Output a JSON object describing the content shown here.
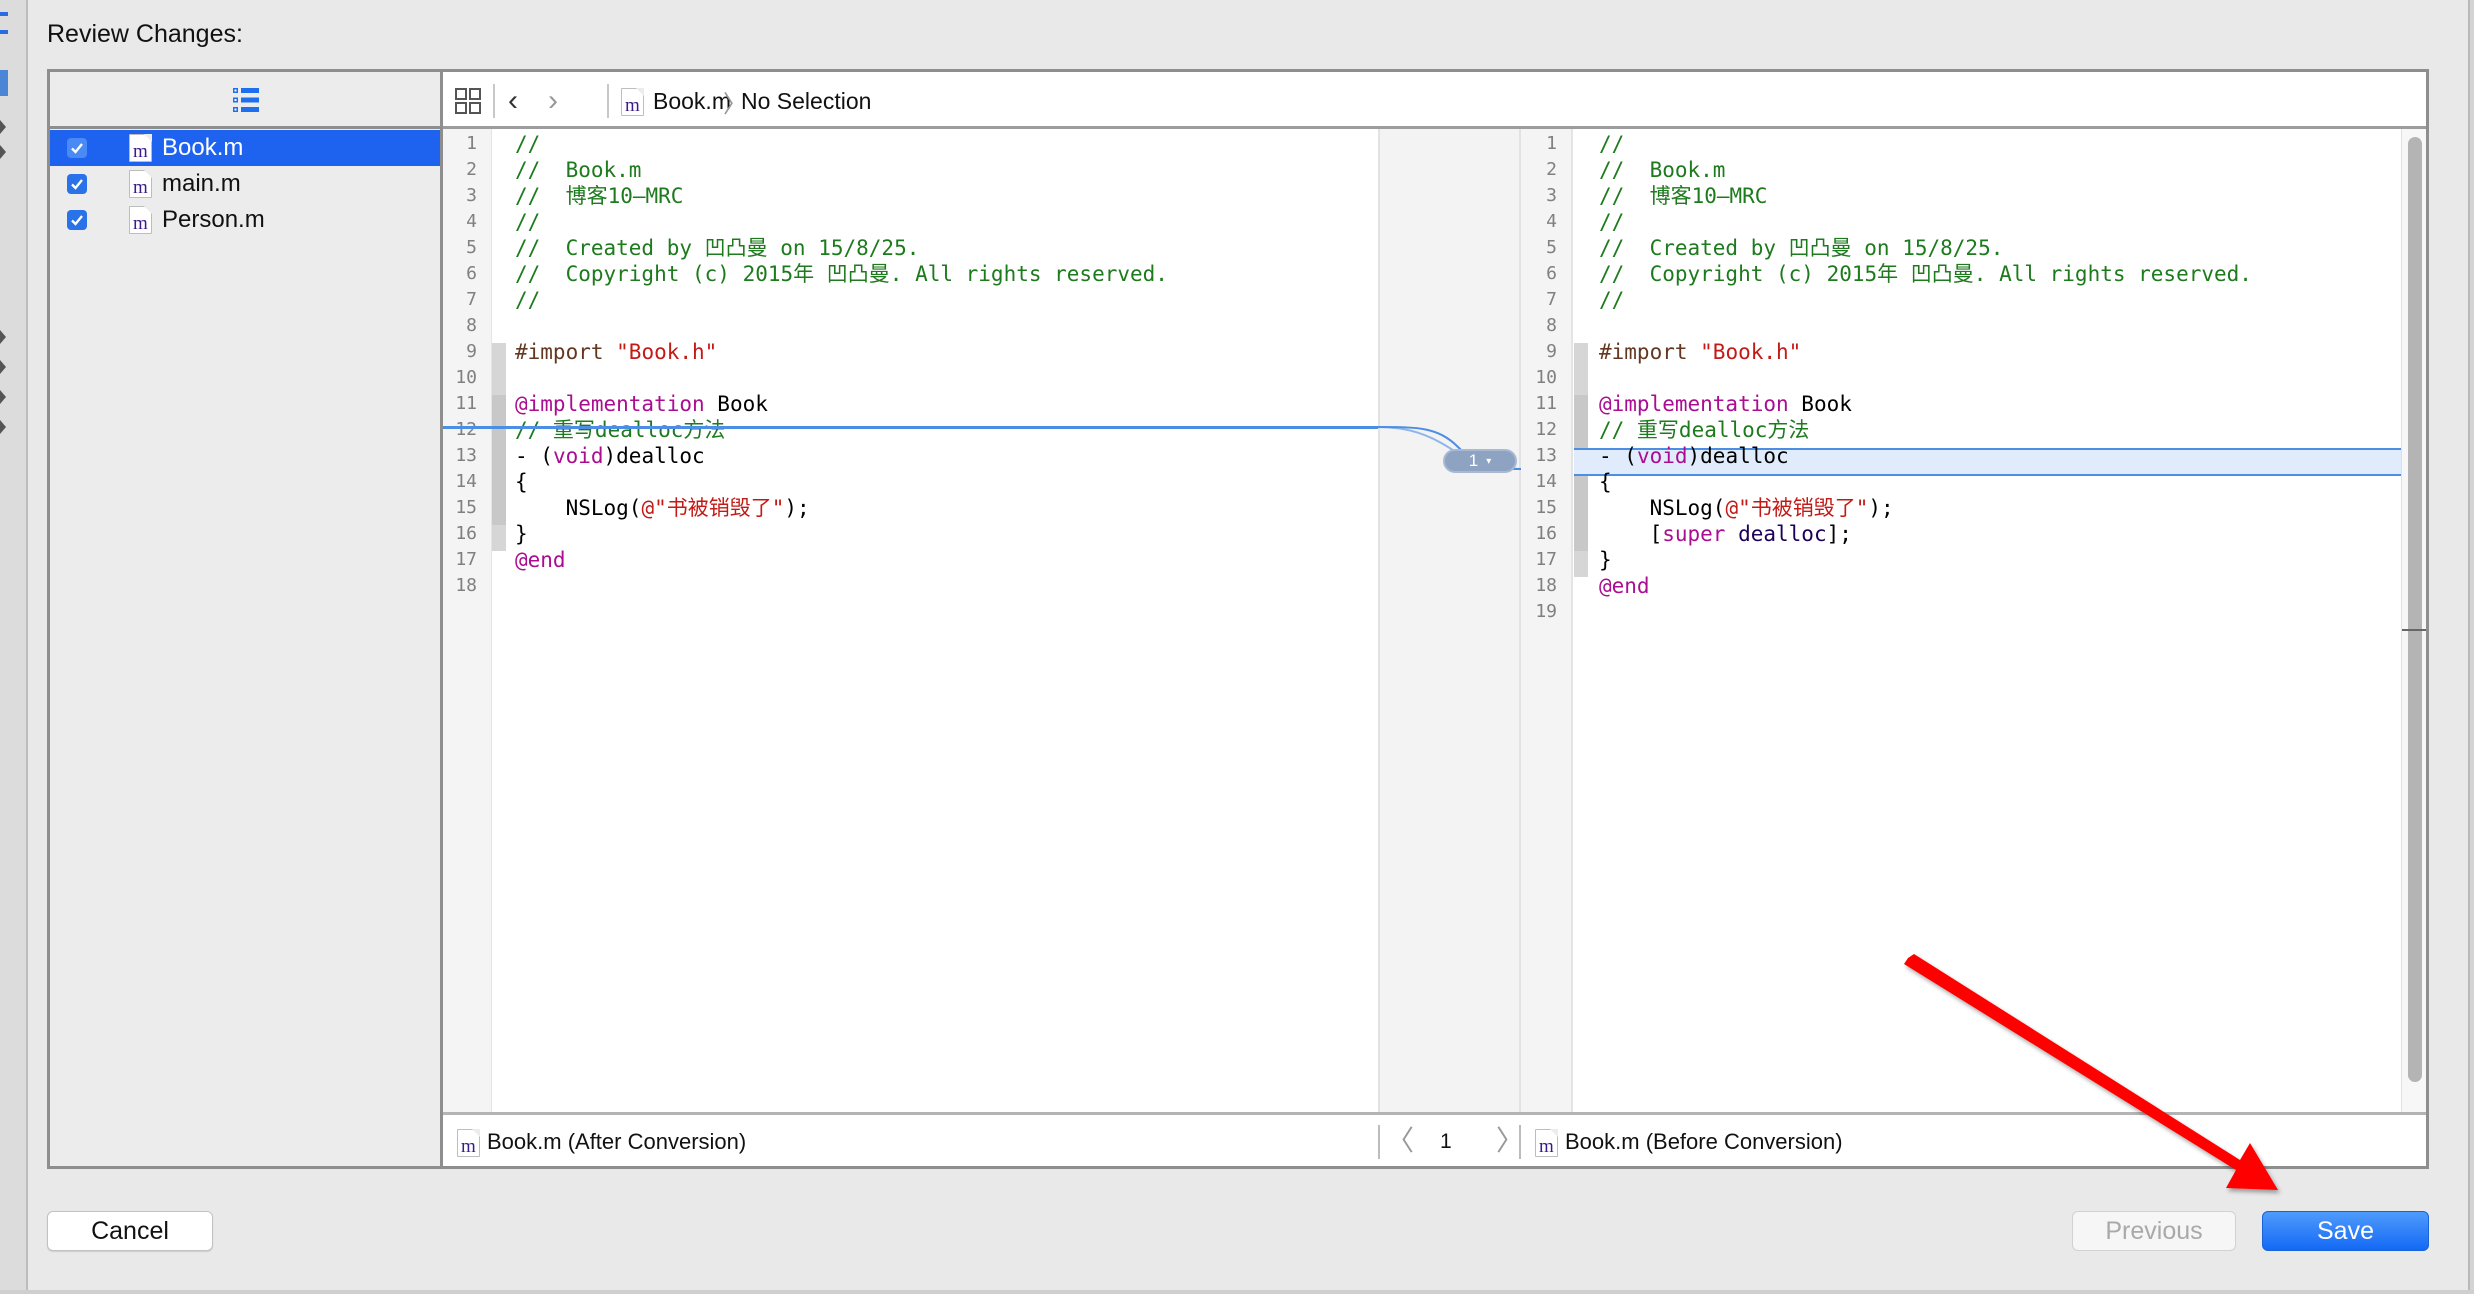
{
  "dialog": {
    "title": "Review Changes:"
  },
  "sidebar": {
    "header_icon": "list-icon",
    "files": [
      {
        "name": "Book.m",
        "checked": true,
        "selected": true,
        "icon": "objc-m-file-icon"
      },
      {
        "name": "main.m",
        "checked": true,
        "selected": false,
        "icon": "objc-m-file-icon"
      },
      {
        "name": "Person.m",
        "checked": true,
        "selected": false,
        "icon": "objc-m-file-icon"
      }
    ]
  },
  "toolbar": {
    "grid_icon": "related-items-icon",
    "back_icon": "chevron-left-icon",
    "forward_icon": "chevron-right-icon",
    "file_icon_glyph": "m",
    "file_name": "Book.m",
    "breadcrumb_separator": "〉",
    "selection": "No Selection"
  },
  "left_pane": {
    "lines": [
      {
        "n": "1",
        "tokens": [
          {
            "t": "//",
            "c": "comment"
          }
        ]
      },
      {
        "n": "2",
        "tokens": [
          {
            "t": "//  Book.m",
            "c": "comment"
          }
        ]
      },
      {
        "n": "3",
        "tokens": [
          {
            "t": "//  博客10—MRC",
            "c": "comment"
          }
        ]
      },
      {
        "n": "4",
        "tokens": [
          {
            "t": "//",
            "c": "comment"
          }
        ]
      },
      {
        "n": "5",
        "tokens": [
          {
            "t": "//  Created by 凹凸曼 on 15/8/25.",
            "c": "comment"
          }
        ]
      },
      {
        "n": "6",
        "tokens": [
          {
            "t": "//  Copyright (c) 2015年 凹凸曼. All rights reserved.",
            "c": "comment"
          }
        ]
      },
      {
        "n": "7",
        "tokens": [
          {
            "t": "//",
            "c": "comment"
          }
        ]
      },
      {
        "n": "8",
        "tokens": []
      },
      {
        "n": "9",
        "tokens": [
          {
            "t": "#import ",
            "c": "preproc"
          },
          {
            "t": "\"Book.h\"",
            "c": "string"
          }
        ]
      },
      {
        "n": "10",
        "tokens": []
      },
      {
        "n": "11",
        "tokens": [
          {
            "t": "@implementation",
            "c": "kw"
          },
          {
            "t": " Book",
            "c": "plain"
          }
        ]
      },
      {
        "n": "12",
        "tokens": [
          {
            "t": "// 重写dealloc方法",
            "c": "comment"
          }
        ]
      },
      {
        "n": "13",
        "tokens": [
          {
            "t": "- (",
            "c": "plain"
          },
          {
            "t": "void",
            "c": "kw"
          },
          {
            "t": ")dealloc",
            "c": "plain"
          }
        ]
      },
      {
        "n": "14",
        "tokens": [
          {
            "t": "{",
            "c": "plain"
          }
        ]
      },
      {
        "n": "15",
        "tokens": [
          {
            "t": "    NSLog(",
            "c": "plain"
          },
          {
            "t": "@\"书被销毁了\"",
            "c": "string"
          },
          {
            "t": ");",
            "c": "plain"
          }
        ]
      },
      {
        "n": "16",
        "tokens": [
          {
            "t": "}",
            "c": "plain"
          }
        ]
      },
      {
        "n": "17",
        "tokens": [
          {
            "t": "@end",
            "c": "kw"
          }
        ]
      },
      {
        "n": "18",
        "tokens": []
      }
    ]
  },
  "right_pane": {
    "lines": [
      {
        "n": "1",
        "tokens": [
          {
            "t": "//",
            "c": "comment"
          }
        ]
      },
      {
        "n": "2",
        "tokens": [
          {
            "t": "//  Book.m",
            "c": "comment"
          }
        ]
      },
      {
        "n": "3",
        "tokens": [
          {
            "t": "//  博客10—MRC",
            "c": "comment"
          }
        ]
      },
      {
        "n": "4",
        "tokens": [
          {
            "t": "//",
            "c": "comment"
          }
        ]
      },
      {
        "n": "5",
        "tokens": [
          {
            "t": "//  Created by 凹凸曼 on 15/8/25.",
            "c": "comment"
          }
        ]
      },
      {
        "n": "6",
        "tokens": [
          {
            "t": "//  Copyright (c) 2015年 凹凸曼. All rights reserved.",
            "c": "comment"
          }
        ]
      },
      {
        "n": "7",
        "tokens": [
          {
            "t": "//",
            "c": "comment"
          }
        ]
      },
      {
        "n": "8",
        "tokens": []
      },
      {
        "n": "9",
        "tokens": [
          {
            "t": "#import ",
            "c": "preproc"
          },
          {
            "t": "\"Book.h\"",
            "c": "string"
          }
        ]
      },
      {
        "n": "10",
        "tokens": []
      },
      {
        "n": "11",
        "tokens": [
          {
            "t": "@implementation",
            "c": "kw"
          },
          {
            "t": " Book",
            "c": "plain"
          }
        ]
      },
      {
        "n": "12",
        "tokens": [
          {
            "t": "// 重写dealloc方法",
            "c": "comment"
          }
        ]
      },
      {
        "n": "13",
        "tokens": [
          {
            "t": "- (",
            "c": "plain"
          },
          {
            "t": "void",
            "c": "kw"
          },
          {
            "t": ")dealloc",
            "c": "plain"
          }
        ]
      },
      {
        "n": "14",
        "tokens": [
          {
            "t": "{",
            "c": "plain"
          }
        ]
      },
      {
        "n": "15",
        "tokens": [
          {
            "t": "    NSLog(",
            "c": "plain"
          },
          {
            "t": "@\"书被销毁了\"",
            "c": "string"
          },
          {
            "t": ");",
            "c": "plain"
          }
        ]
      },
      {
        "n": "16",
        "tokens": [
          {
            "t": "    [",
            "c": "plain"
          },
          {
            "t": "super",
            "c": "kw"
          },
          {
            "t": " dealloc",
            "c": "class"
          },
          {
            "t": "];",
            "c": "plain"
          }
        ]
      },
      {
        "n": "17",
        "tokens": [
          {
            "t": "}",
            "c": "plain"
          }
        ]
      },
      {
        "n": "18",
        "tokens": [
          {
            "t": "@end",
            "c": "kw"
          }
        ]
      },
      {
        "n": "19",
        "tokens": []
      }
    ]
  },
  "diff": {
    "change_count_label": "1",
    "caret": "▾",
    "highlight_color": "#e0ecfb",
    "line_color": "#4c8ee4"
  },
  "footer": {
    "left_label": "Book.m (After Conversion)",
    "right_label": "Book.m (Before Conversion)",
    "change_index": "1",
    "prev_glyph": "〈",
    "next_glyph": "〉"
  },
  "buttons": {
    "cancel": "Cancel",
    "previous": "Previous",
    "save": "Save",
    "save_color": "#1a6ef5"
  },
  "annotation": {
    "type": "red-arrow",
    "points_to": "save-button",
    "color": "#ff0000"
  }
}
